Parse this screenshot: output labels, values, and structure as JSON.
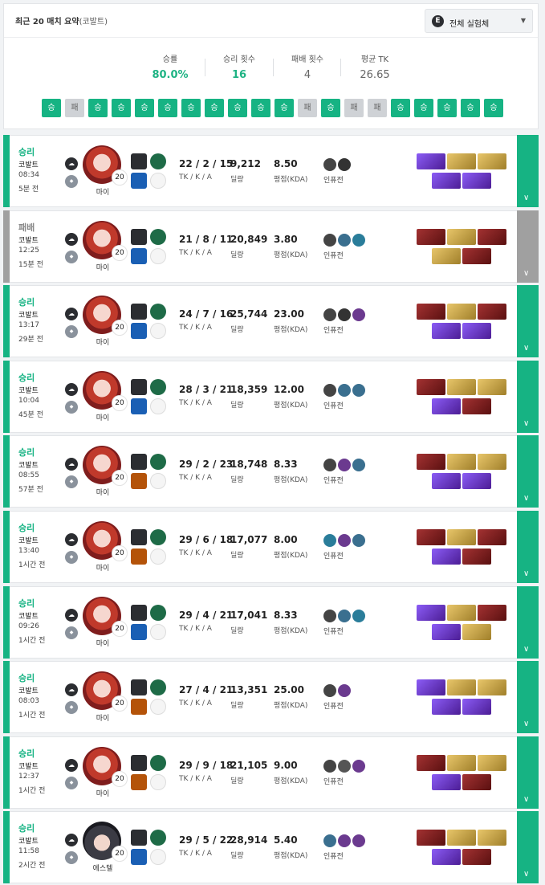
{
  "summary": {
    "title": "최근 20 매치 요약",
    "title_sub": "(코발트)",
    "filter": {
      "logo": "E",
      "label": "전체 실험체"
    },
    "stats": [
      {
        "label": "승률",
        "value": "80.0%"
      },
      {
        "label": "승리 횟수",
        "value": "16"
      },
      {
        "label": "패배 횟수",
        "value": "4"
      },
      {
        "label": "평균 TK",
        "value": "26.65"
      }
    ],
    "streak": [
      "승",
      "패",
      "승",
      "승",
      "승",
      "승",
      "승",
      "승",
      "승",
      "승",
      "승",
      "패",
      "승",
      "패",
      "패",
      "승",
      "승",
      "승",
      "승",
      "승"
    ]
  },
  "labels": {
    "kda": "TK / K / A",
    "damage": "딜량",
    "score": "평점(KDA)",
    "augment": "인퓨전"
  },
  "matches": [
    {
      "result": "승리",
      "mode": "코발트",
      "time": "08:34",
      "ago": "5분 전",
      "level": "20",
      "character": "마이",
      "tk": "22",
      "k": "2",
      "a": "15",
      "damage": "9,212",
      "score": "8.50"
    },
    {
      "result": "패배",
      "mode": "코발트",
      "time": "12:25",
      "ago": "15분 전",
      "level": "20",
      "character": "마이",
      "tk": "21",
      "k": "8",
      "a": "11",
      "damage": "20,849",
      "score": "3.80"
    },
    {
      "result": "승리",
      "mode": "코발트",
      "time": "13:17",
      "ago": "29분 전",
      "level": "20",
      "character": "마이",
      "tk": "24",
      "k": "7",
      "a": "16",
      "damage": "25,744",
      "score": "23.00"
    },
    {
      "result": "승리",
      "mode": "코발트",
      "time": "10:04",
      "ago": "45분 전",
      "level": "20",
      "character": "마이",
      "tk": "28",
      "k": "3",
      "a": "21",
      "damage": "18,359",
      "score": "12.00"
    },
    {
      "result": "승리",
      "mode": "코발트",
      "time": "08:55",
      "ago": "57분 전",
      "level": "20",
      "character": "마이",
      "tk": "29",
      "k": "2",
      "a": "23",
      "damage": "18,748",
      "score": "8.33"
    },
    {
      "result": "승리",
      "mode": "코발트",
      "time": "13:40",
      "ago": "1시간 전",
      "level": "20",
      "character": "마이",
      "tk": "29",
      "k": "6",
      "a": "18",
      "damage": "17,077",
      "score": "8.00"
    },
    {
      "result": "승리",
      "mode": "코발트",
      "time": "09:26",
      "ago": "1시간 전",
      "level": "20",
      "character": "마이",
      "tk": "29",
      "k": "4",
      "a": "21",
      "damage": "17,041",
      "score": "8.33"
    },
    {
      "result": "승리",
      "mode": "코발트",
      "time": "08:03",
      "ago": "1시간 전",
      "level": "20",
      "character": "마이",
      "tk": "27",
      "k": "4",
      "a": "21",
      "damage": "13,351",
      "score": "25.00"
    },
    {
      "result": "승리",
      "mode": "코발트",
      "time": "12:37",
      "ago": "1시간 전",
      "level": "20",
      "character": "마이",
      "tk": "29",
      "k": "9",
      "a": "18",
      "damage": "21,105",
      "score": "9.00"
    },
    {
      "result": "승리",
      "mode": "코발트",
      "time": "11:58",
      "ago": "2시간 전",
      "level": "20",
      "character": "에스텔",
      "tk": "29",
      "k": "5",
      "a": "22",
      "damage": "28,914",
      "score": "5.40"
    }
  ],
  "colors": {
    "win": "#16b383",
    "loss": "#a0a0a0",
    "win_text": "#1fb384"
  }
}
